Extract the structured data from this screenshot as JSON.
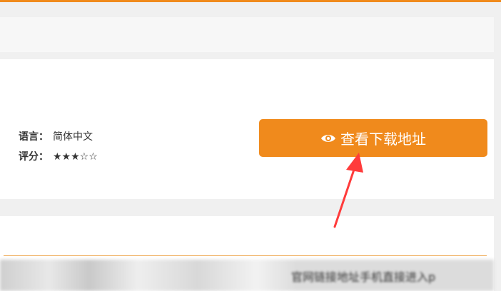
{
  "info": {
    "language_label": "语言：",
    "language_value": "简体中文",
    "rating_label": "评分：",
    "rating_stars": "★★★☆☆",
    "rating_value": 3,
    "rating_max": 5
  },
  "download_button": {
    "label": "查看下载地址",
    "icon": "eye-icon"
  },
  "content": {
    "blurred_text": "官网链接地址手机直接进入p"
  },
  "colors": {
    "accent": "#f08a1c",
    "annotation_arrow": "#ff3b3b"
  }
}
